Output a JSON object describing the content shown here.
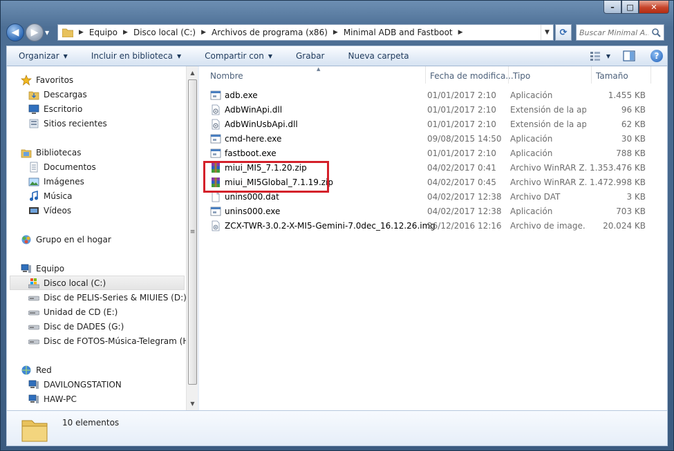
{
  "window": {
    "minimize_label": "–",
    "maximize_label": "□",
    "close_label": "✕"
  },
  "nav": {
    "back_glyph": "◀",
    "forward_glyph": "▶"
  },
  "address": {
    "crumbs": [
      "Equipo",
      "Disco local (C:)",
      "Archivos de programa (x86)",
      "Minimal ADB and Fastboot"
    ],
    "search_placeholder": "Buscar Minimal A..."
  },
  "toolbar": {
    "organize": "Organizar",
    "include_library": "Incluir en biblioteca",
    "share_with": "Compartir con",
    "burn": "Grabar",
    "new_folder": "Nueva carpeta",
    "help": "?"
  },
  "navpane": {
    "favorites": {
      "label": "Favoritos",
      "items": [
        "Descargas",
        "Escritorio",
        "Sitios recientes"
      ]
    },
    "libraries": {
      "label": "Bibliotecas",
      "items": [
        "Documentos",
        "Imágenes",
        "Música",
        "Vídeos"
      ]
    },
    "homegroup": "Grupo en el hogar",
    "computer": {
      "label": "Equipo",
      "items": [
        "Disco local (C:)",
        "Disc de PELIS-Series & MIUIES (D:)",
        "Unidad de CD (E:)",
        "Disc de DADES (G:)",
        "Disc de FOTOS-Música-Telegram (H:)"
      ],
      "selected": "Disco local (C:)"
    },
    "network": {
      "label": "Red",
      "items": [
        "DAVILONGSTATION",
        "HAW-PC"
      ]
    }
  },
  "columns": {
    "name": "Nombre",
    "date": "Fecha de modifica...",
    "type": "Tipo",
    "size": "Tamaño"
  },
  "files": [
    {
      "name": "adb.exe",
      "date": "01/01/2017 2:10",
      "type": "Aplicación",
      "size": "1.455 KB",
      "icon": "exe-icon"
    },
    {
      "name": "AdbWinApi.dll",
      "date": "01/01/2017 2:10",
      "type": "Extensión de la apl...",
      "size": "96 KB",
      "icon": "dll-icon"
    },
    {
      "name": "AdbWinUsbApi.dll",
      "date": "01/01/2017 2:10",
      "type": "Extensión de la apl...",
      "size": "62 KB",
      "icon": "dll-icon"
    },
    {
      "name": "cmd-here.exe",
      "date": "09/08/2015 14:50",
      "type": "Aplicación",
      "size": "30 KB",
      "icon": "exe-icon"
    },
    {
      "name": "fastboot.exe",
      "date": "01/01/2017 2:10",
      "type": "Aplicación",
      "size": "788 KB",
      "icon": "exe-icon"
    },
    {
      "name": "miui_MI5_7.1.20.zip",
      "date": "04/02/2017 0:41",
      "type": "Archivo WinRAR Z...",
      "size": "1.353.476 KB",
      "icon": "winrar-icon"
    },
    {
      "name": "miui_MI5Global_7.1.19.zip",
      "date": "04/02/2017 0:45",
      "type": "Archivo WinRAR Z...",
      "size": "1.472.998 KB",
      "icon": "winrar-icon"
    },
    {
      "name": "unins000.dat",
      "date": "04/02/2017 12:38",
      "type": "Archivo DAT",
      "size": "3 KB",
      "icon": "dat-icon"
    },
    {
      "name": "unins000.exe",
      "date": "04/02/2017 12:38",
      "type": "Aplicación",
      "size": "703 KB",
      "icon": "exe-icon"
    },
    {
      "name": "ZCX-TWR-3.0.2-X-MI5-Gemini-7.0dec_16.12.26.img",
      "date": "26/12/2016 12:16",
      "type": "Archivo de image...",
      "size": "20.024 KB",
      "icon": "img-icon"
    }
  ],
  "details": {
    "count": "10 elementos"
  },
  "colors": {
    "highlight": "#d4202a",
    "window_frame": "#3b5b80",
    "toolbar_text": "#1e395b"
  }
}
